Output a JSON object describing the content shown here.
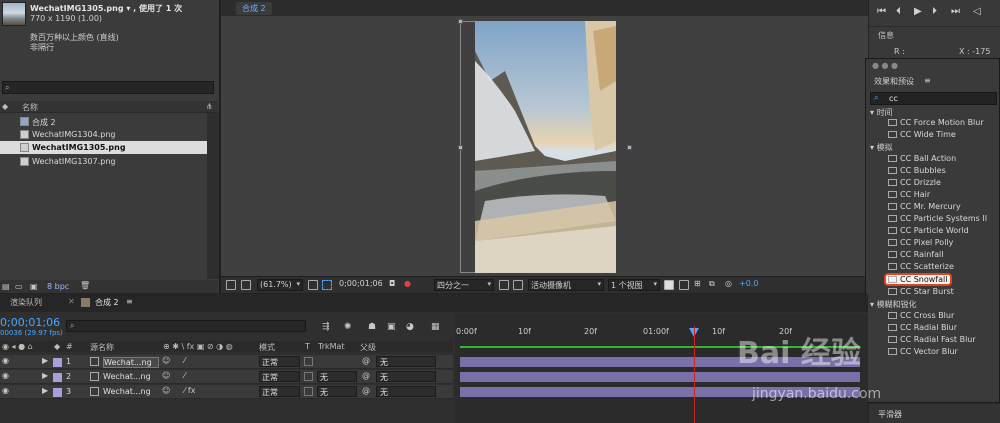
{
  "project": {
    "file_name": "WechatIMG1305.png ▾ , 使用了 1 次",
    "dimensions": "770 x 1190 (1.00)",
    "color": "数百万种以上颜色 (直线)",
    "interlace": "非隔行",
    "column_name": "名称",
    "items": [
      {
        "label": "合成 2",
        "type": "comp"
      },
      {
        "label": "WechatIMG1304.png",
        "type": "file"
      },
      {
        "label": "WechatIMG1305.png",
        "type": "file"
      },
      {
        "label": "WechatIMG1307.png",
        "type": "file"
      }
    ],
    "bpc": "8 bpc"
  },
  "viewer": {
    "tab": "合成 2",
    "zoom": "(61.7%)",
    "timecode": "0;00;01;06",
    "resolution": "四分之一",
    "camera": "活动摄像机",
    "views": "1 个视图",
    "exposure": "+0.0"
  },
  "right_panel": {
    "info_title": "信息",
    "info_r": "R :",
    "info_x": "X : -175",
    "effects_title": "效果和预设",
    "search_value": "cc",
    "categories": [
      {
        "name": "时间",
        "items": [
          "CC Force Motion Blur",
          "CC Wide Time"
        ]
      },
      {
        "name": "模拟",
        "items": [
          "CC Ball Action",
          "CC Bubbles",
          "CC Drizzle",
          "CC Hair",
          "CC Mr. Mercury",
          "CC Particle Systems II",
          "CC Particle World",
          "CC Pixel Polly",
          "CC Rainfall",
          "CC Scatterize",
          "CC Snowfall",
          "CC Star Burst"
        ]
      },
      {
        "name": "模糊和锐化",
        "items": [
          "CC Cross Blur",
          "CC Radial Blur",
          "CC Radial Fast Blur",
          "CC Vector Blur"
        ]
      }
    ],
    "highlighted": "CC Snowfall",
    "smoother": "平滑器"
  },
  "timeline": {
    "tabs": [
      "渲染队列",
      "合成 2"
    ],
    "timecode": "0;00;01;06",
    "fps": "00036 (29.97 fps)",
    "col_source": "源名称",
    "col_mode": "模式",
    "col_t": "T",
    "col_trkmat": "TrkMat",
    "col_parent": "父级",
    "col_hash": "#",
    "layers": [
      {
        "num": "1",
        "name": "Wechat...ng",
        "mode": "正常",
        "trkmat": "",
        "parent": "无"
      },
      {
        "num": "2",
        "name": "Wechat...ng",
        "mode": "正常",
        "trkmat": "无",
        "parent": "无"
      },
      {
        "num": "3",
        "name": "Wechat...ng",
        "mode": "正常",
        "trkmat": "无",
        "parent": "无"
      }
    ],
    "ruler": [
      "0:00f",
      "10f",
      "20f",
      "01:00f",
      "10f",
      "20f"
    ]
  },
  "watermark": {
    "brand": "Bai 经验",
    "url": "jingyan.baidu.com"
  }
}
